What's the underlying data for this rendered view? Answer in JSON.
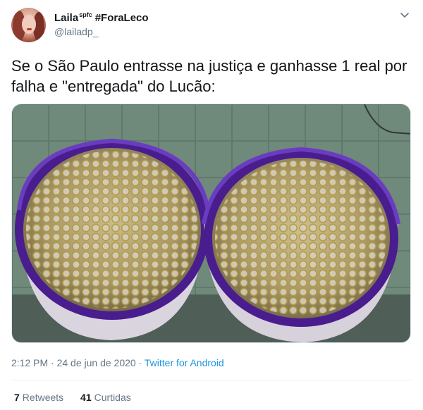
{
  "user": {
    "name": "Laila",
    "name_superscript": "spfc",
    "name_hashtag": "#ForaLeco",
    "handle": "@lailadp_"
  },
  "tweet": {
    "text": "Se o São Paulo entrasse na justiça e ganhasse 1 real por falha e \"entregada\" do Lucão:",
    "timestamp": "2:12 PM · 24 de jun de 2020",
    "separator": " · ",
    "source": "Twitter for Android"
  },
  "stats": {
    "retweets_count": "7",
    "retweets_label": "Retweets",
    "likes_count": "41",
    "likes_label": "Curtidas"
  },
  "icons": {
    "caret": "chevron-down-icon"
  },
  "colors": {
    "link": "#1b95e0",
    "secondary_text": "#657786",
    "bucket_purple": "#5b2a9e"
  }
}
